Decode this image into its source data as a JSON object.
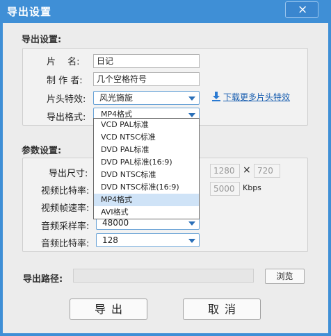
{
  "window": {
    "title": "导出设置",
    "close_icon": "×"
  },
  "export_settings": {
    "header": "导出设置:",
    "title_label": "片　 名:",
    "title_value": "日记",
    "author_label": "制 作 者:",
    "author_value": "几个空格符号",
    "intro_effect_label": "片头特效:",
    "intro_effect_value": "风光旖旎",
    "download_link": "下载更多片头特效",
    "format_label": "导出格式:",
    "format_value": "MP4格式"
  },
  "format_dropdown": {
    "options": [
      "VCD PAL标准",
      "VCD NTSC标准",
      "DVD PAL标准",
      "DVD PAL标准(16:9)",
      "DVD NTSC标准",
      "DVD NTSC标准(16:9)",
      "MP4格式",
      "AVI格式"
    ],
    "selected": "MP4格式"
  },
  "param_settings": {
    "header": "参数设置:",
    "size_label": "导出尺寸:",
    "width": "1280",
    "times": "×",
    "height": "720",
    "video_bitrate_label": "视频比特率:",
    "video_bitrate": "5000",
    "bitrate_unit": "Kbps",
    "framerate_label": "视频帧速率:",
    "audio_sample_label": "音频采样率:",
    "audio_sample_value": "48000",
    "audio_bitrate_label": "音频比特率:",
    "audio_bitrate_value": "128"
  },
  "export_path": {
    "label": "导出路径:",
    "value": "",
    "browse": "浏览"
  },
  "buttons": {
    "export": "导出",
    "cancel": "取消"
  },
  "colors": {
    "titlebar": "#3f8fd6",
    "selection": "#cfe3f7",
    "link": "#1a5fb0"
  }
}
